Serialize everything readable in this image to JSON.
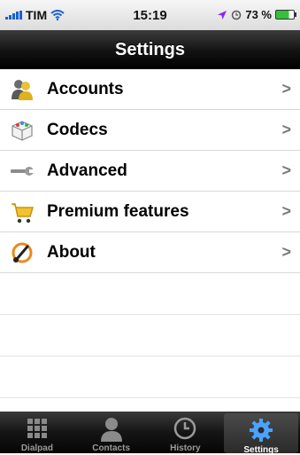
{
  "status_bar": {
    "carrier": "TIM",
    "time": "15:19",
    "battery_percent": "73 %",
    "battery_level": 0.73,
    "icons": [
      "signal-icon",
      "wifi-icon",
      "location-icon",
      "alarm-icon",
      "battery-icon"
    ]
  },
  "nav": {
    "title": "Settings"
  },
  "settings_items": [
    {
      "label": "Accounts",
      "icon": "accounts-icon"
    },
    {
      "label": "Codecs",
      "icon": "codecs-icon"
    },
    {
      "label": "Advanced",
      "icon": "wrench-icon"
    },
    {
      "label": "Premium features",
      "icon": "cart-icon"
    },
    {
      "label": "About",
      "icon": "about-icon"
    }
  ],
  "chevron": ">",
  "tabs": [
    {
      "label": "Dialpad",
      "icon": "dialpad-icon",
      "active": false
    },
    {
      "label": "Contacts",
      "icon": "contacts-icon",
      "active": false
    },
    {
      "label": "History",
      "icon": "clock-icon",
      "active": false
    },
    {
      "label": "Settings",
      "icon": "gear-icon",
      "active": true
    }
  ],
  "colors": {
    "accent": "#1a5fd1",
    "active_tab_icon": "#4aa3ff"
  }
}
